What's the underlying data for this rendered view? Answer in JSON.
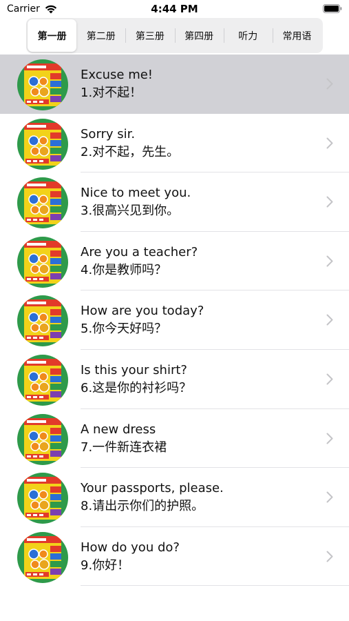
{
  "status_bar": {
    "carrier": "Carrier",
    "time": "4:44 PM",
    "icons": [
      "wifi-icon",
      "battery-icon"
    ]
  },
  "tabs": [
    {
      "label": "第一册",
      "selected": true
    },
    {
      "label": "第二册",
      "selected": false
    },
    {
      "label": "第三册",
      "selected": false
    },
    {
      "label": "第四册",
      "selected": false
    },
    {
      "label": "听力",
      "selected": false
    },
    {
      "label": "常用语",
      "selected": false
    }
  ],
  "lessons": [
    {
      "english": "Excuse me!",
      "chinese": "1.对不起！",
      "highlighted": true
    },
    {
      "english": "Sorry sir.",
      "chinese": "2.对不起，先生。",
      "highlighted": false
    },
    {
      "english": "Nice to meet you.",
      "chinese": "3.很高兴见到你。",
      "highlighted": false
    },
    {
      "english": "Are you a teacher?",
      "chinese": "4.你是教师吗？",
      "highlighted": false
    },
    {
      "english": "How are you today?",
      "chinese": "5.你今天好吗？",
      "highlighted": false
    },
    {
      "english": "Is this your shirt?",
      "chinese": "6.这是你的衬衫吗？",
      "highlighted": false
    },
    {
      "english": "A new dress",
      "chinese": "7.一件新连衣裙",
      "highlighted": false
    },
    {
      "english": "Your passports, please.",
      "chinese": "8.请出示你们的护照。",
      "highlighted": false
    },
    {
      "english": "How do you do?",
      "chinese": "9.你好！",
      "highlighted": false
    }
  ],
  "colors": {
    "highlight_row": "#d1d1d6",
    "segment_bg": "#eeeeef",
    "chevron": "#c4c4c7"
  }
}
